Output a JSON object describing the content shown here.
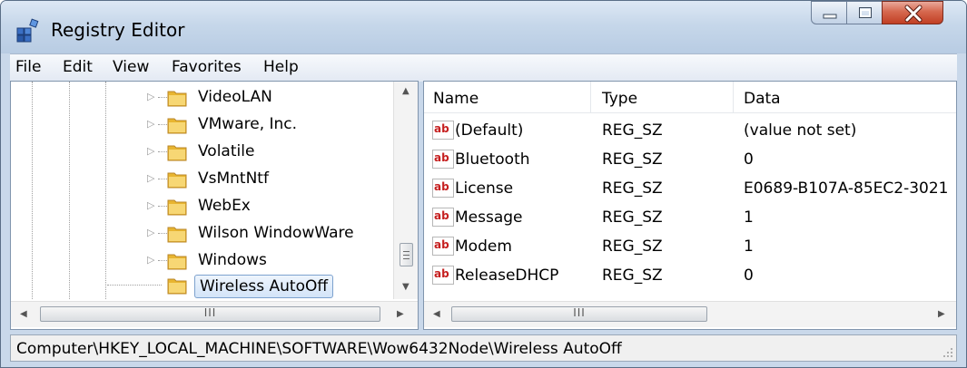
{
  "window": {
    "title": "Registry Editor",
    "icon": "registry-editor-icon",
    "controls": {
      "minimize": "minimize-icon",
      "maximize": "maximize-icon",
      "close": "close-icon"
    },
    "accent_close": "#c7432a"
  },
  "menu": [
    "File",
    "Edit",
    "View",
    "Favorites",
    "Help"
  ],
  "tree": {
    "nodes": [
      {
        "label": "VideoLAN",
        "expander": "▷"
      },
      {
        "label": "VMware, Inc.",
        "expander": "▷"
      },
      {
        "label": "Volatile",
        "expander": "▷"
      },
      {
        "label": "VsMntNtf",
        "expander": "▷"
      },
      {
        "label": "WebEx",
        "expander": "▷"
      },
      {
        "label": "Wilson WindowWare",
        "expander": "▷"
      },
      {
        "label": "Windows",
        "expander": "▷"
      },
      {
        "label": "Wireless AutoOff",
        "expander": "",
        "selected": true
      }
    ],
    "hscroll_grip": "III"
  },
  "list": {
    "columns": {
      "name": "Name",
      "type": "Type",
      "data": "Data"
    },
    "icon_text": "ab",
    "rows": [
      {
        "name": "(Default)",
        "type": "REG_SZ",
        "data": "(value not set)"
      },
      {
        "name": "Bluetooth",
        "type": "REG_SZ",
        "data": "0"
      },
      {
        "name": "License",
        "type": "REG_SZ",
        "data": "E0689-B107A-85EC2-3021"
      },
      {
        "name": "Message",
        "type": "REG_SZ",
        "data": "1"
      },
      {
        "name": "Modem",
        "type": "REG_SZ",
        "data": "1"
      },
      {
        "name": "ReleaseDHCP",
        "type": "REG_SZ",
        "data": "0"
      }
    ],
    "hscroll_grip": "III"
  },
  "status": {
    "path": "Computer\\HKEY_LOCAL_MACHINE\\SOFTWARE\\Wow6432Node\\Wireless AutoOff"
  }
}
